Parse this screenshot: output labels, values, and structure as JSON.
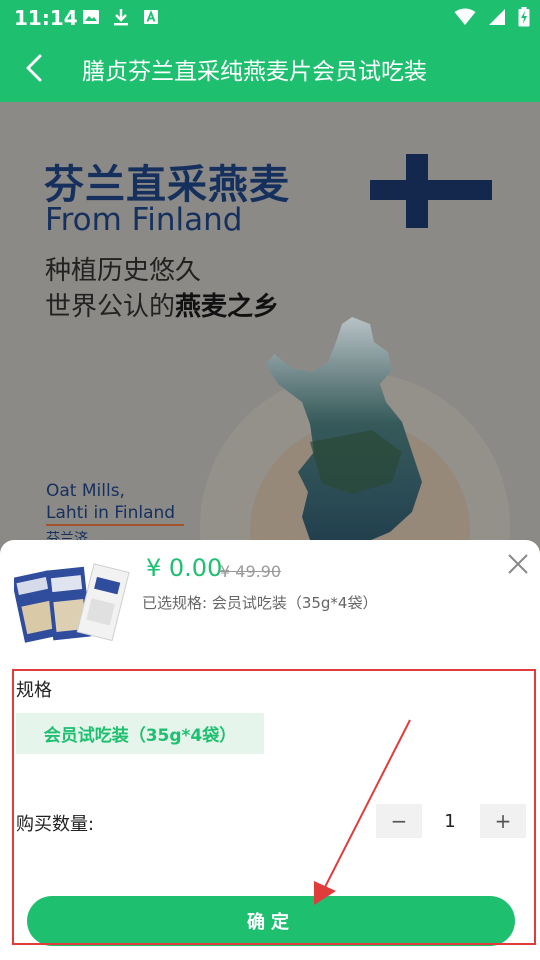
{
  "status_bar": {
    "time": "11:14",
    "left_icons": [
      "image-icon",
      "download-icon",
      "font-icon"
    ],
    "right_icons": [
      "wifi-icon",
      "signal-icon",
      "battery-charging-icon"
    ]
  },
  "header": {
    "title": "膳贞芬兰直采纯燕麦片会员试吃装",
    "back_icon": "chevron-left-icon"
  },
  "banner": {
    "title": "芬兰直采燕麦",
    "subtitle": "From Finland",
    "line1": "种植历史悠久",
    "line2_prefix": "世界公认的",
    "line2_bold": "燕麦之乡",
    "note_line1": "Oat Mills,",
    "note_line2": "Lahti in Finland",
    "note_cn": "芬兰济"
  },
  "product": {
    "price": "¥ 0.00",
    "original_price": "¥ 49.90",
    "selected_spec": "已选规格: 会员试吃装（35g*4袋）"
  },
  "spec": {
    "label": "规格",
    "option": "会员试吃装（35g*4袋）"
  },
  "quantity": {
    "label": "购买数量:",
    "minus": "−",
    "value": "1",
    "plus": "+"
  },
  "confirm": {
    "label": "确定"
  },
  "colors": {
    "brand_green": "#1ec070",
    "annotation_red": "#e03c3c",
    "navy": "#16305e"
  }
}
